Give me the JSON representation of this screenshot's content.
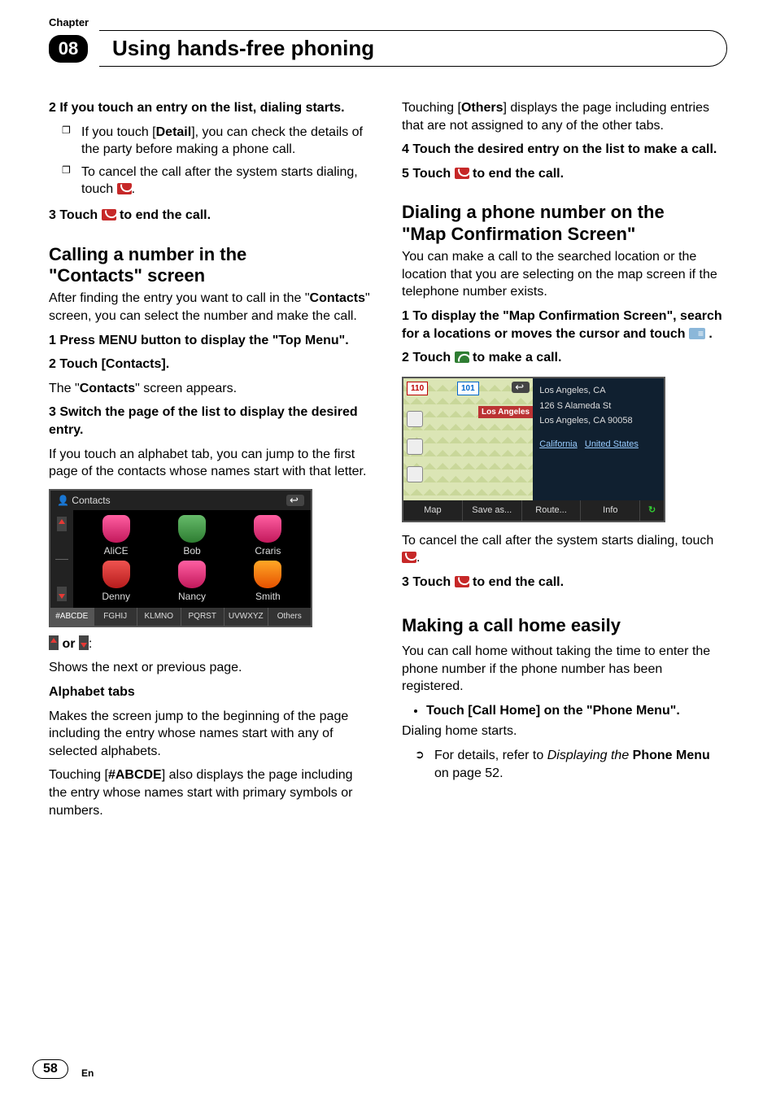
{
  "header": {
    "chapter_label": "Chapter",
    "chapter_number": "08",
    "title": "Using hands-free phoning"
  },
  "left": {
    "step2_heading": "2    If you touch an entry on the list, dialing starts.",
    "bullets_a": "If you touch [",
    "detail_word": "Detail",
    "bullets_a2": "], you can check the details of the party before making a phone call.",
    "bullets_b": "To cancel the call after the system starts dialing, touch ",
    "bullets_b_end": ".",
    "step3_touch": "3    Touch ",
    "step3_end": " to end the call.",
    "h_calling_1": "Calling a number in the",
    "h_calling_2": "\"Contacts\" screen",
    "calling_body": "After finding the entry you want to call in the \"",
    "contacts_word": "Contacts",
    "calling_body2": "\" screen, you can select the number and make the call.",
    "step_cs_1": "1    Press MENU button to display the \"Top Menu\".",
    "step_cs_2": "2    Touch [Contacts].",
    "step_cs_2_body_a": "The \"",
    "step_cs_2_body_b": "\" screen appears.",
    "step_cs_3": "3    Switch the page of the list to display the desired entry.",
    "step_cs_3_body": "If you touch an alphabet tab, you can jump to the first page of the contacts whose names start with that letter.",
    "contacts_shot": {
      "title": "Contacts",
      "names": [
        "AliCE",
        "Bob",
        "Craris",
        "Denny",
        "Nancy",
        "Smith"
      ],
      "tabs": [
        "#ABCDE",
        "FGHIJ",
        "KLMNO",
        "PQRST",
        "UVWXYZ",
        "Others"
      ]
    },
    "arrows_label_sep": " or ",
    "arrows_label_end": ":",
    "arrows_desc": "Shows the next or previous page.",
    "alpha_heading": "Alphabet tabs",
    "alpha_body": "Makes the screen jump to the beginning of the page including the entry whose names start with any of selected alphabets.",
    "alpha_body2a": "Touching [",
    "alpha_hash": "#ABCDE",
    "alpha_body2b": "] also displays the page including the entry whose names start with primary symbols or numbers."
  },
  "right": {
    "others_a": "Touching [",
    "others_word": "Others",
    "others_b": "] displays the page including entries that are not assigned to any of the other tabs.",
    "step4": "4    Touch the desired entry on the list to make a call.",
    "step5_a": "5    Touch ",
    "step5_b": " to end the call.",
    "h_dial_1": "Dialing a phone number on the",
    "h_dial_2": "\"Map Confirmation Screen\"",
    "dial_body": "You can make a call to the searched location or the location that you are selecting on the map screen if the telephone number exists.",
    "dial_step1_a": "1    To display the \"Map Confirmation Screen\", search for a locations or moves the cursor and touch ",
    "dial_step1_b": " .",
    "dial_step2_a": "2    Touch ",
    "dial_step2_b": " to make a call.",
    "map_shot": {
      "badge110": "110",
      "badge101": "101",
      "label_la": "Los Angeles",
      "city_line": "Los Angeles, CA",
      "addr_line": "126 S Alameda St",
      "zip_line": "Los Angeles, CA 90058",
      "region_a": "California",
      "region_b": "United States",
      "footer": [
        "Map",
        "Save as...",
        "Route...",
        "Info",
        "↻"
      ]
    },
    "cancel_body_a": "To cancel the call after the system starts dialing, touch ",
    "cancel_body_b": ".",
    "step3_a": "3    Touch ",
    "step3_b": " to end the call.",
    "h_home": "Making a call home easily",
    "home_body": "You can call home without taking the time to enter the phone number if the phone number has been registered.",
    "home_bullet": "Touch [Call Home] on the \"Phone Menu\".",
    "home_start": "Dialing home starts.",
    "xref_a": "For details, refer to ",
    "xref_i": "Displaying the",
    "xref_b": " Phone Menu",
    "xref_c": " on page 52."
  },
  "footer": {
    "page_num": "58",
    "lang": "En"
  }
}
